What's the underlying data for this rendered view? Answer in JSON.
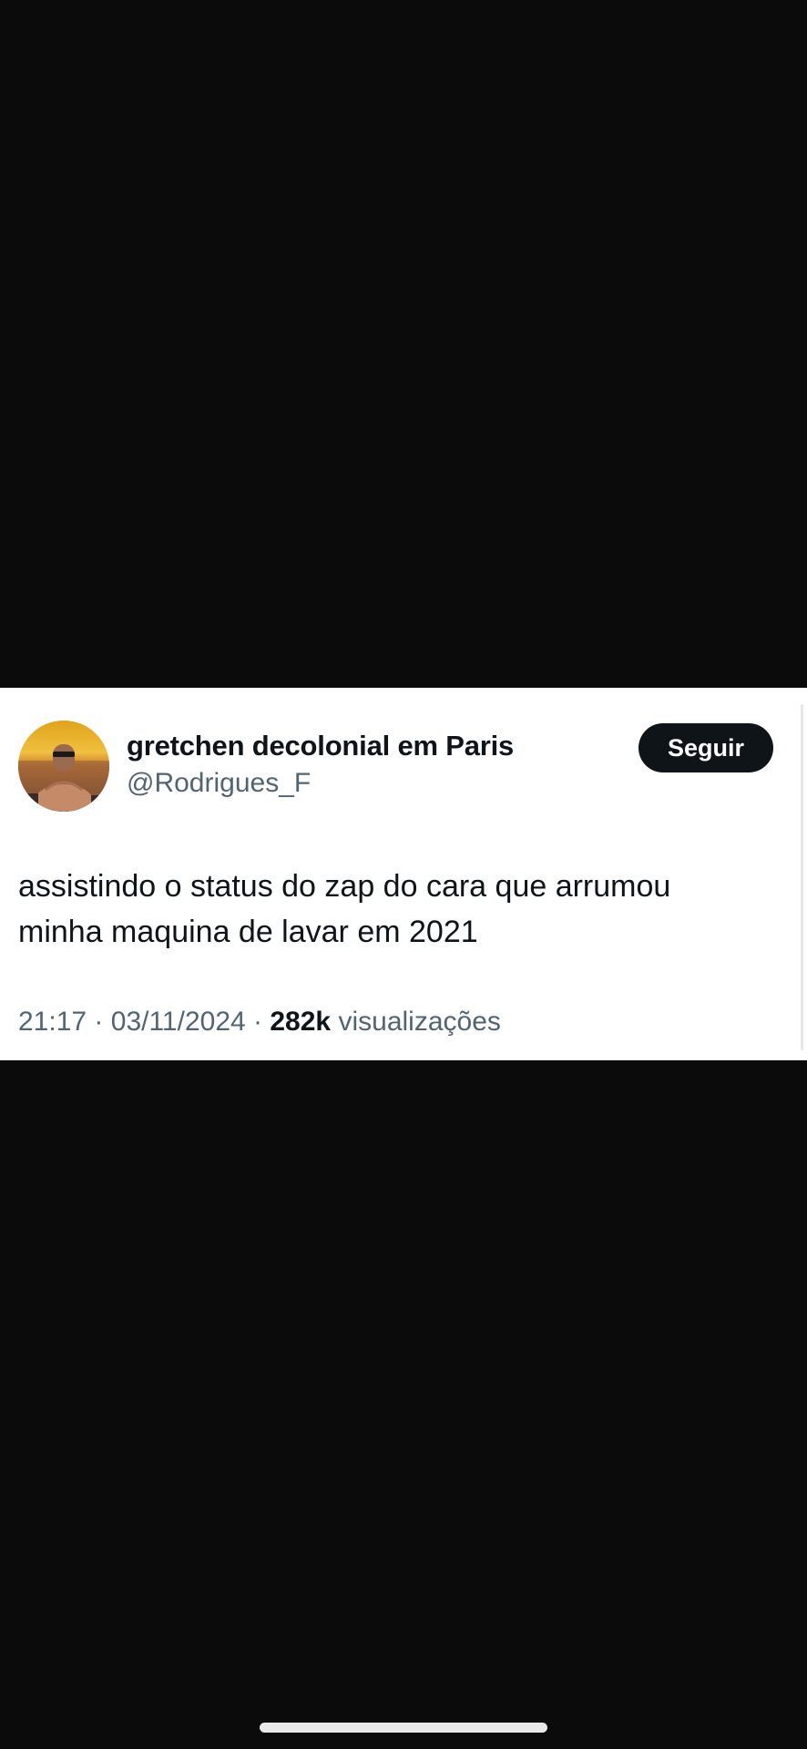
{
  "tweet": {
    "author": {
      "display_name": "gretchen decolonial em Paris",
      "handle": "@Rodrigues_F"
    },
    "follow_label": "Seguir",
    "text_lines": [
      "assistindo o status do zap do cara que arrumou",
      "minha maquina de lavar em 2021"
    ],
    "time": "21:17",
    "separator": "·",
    "date": "03/11/2024",
    "views_count": "282k",
    "views_label": "visualizações"
  },
  "colors": {
    "background": "#0b0b0b",
    "card": "#ffffff",
    "text_primary": "#0f1419",
    "text_secondary": "#536471",
    "button_bg": "#0f1419"
  }
}
